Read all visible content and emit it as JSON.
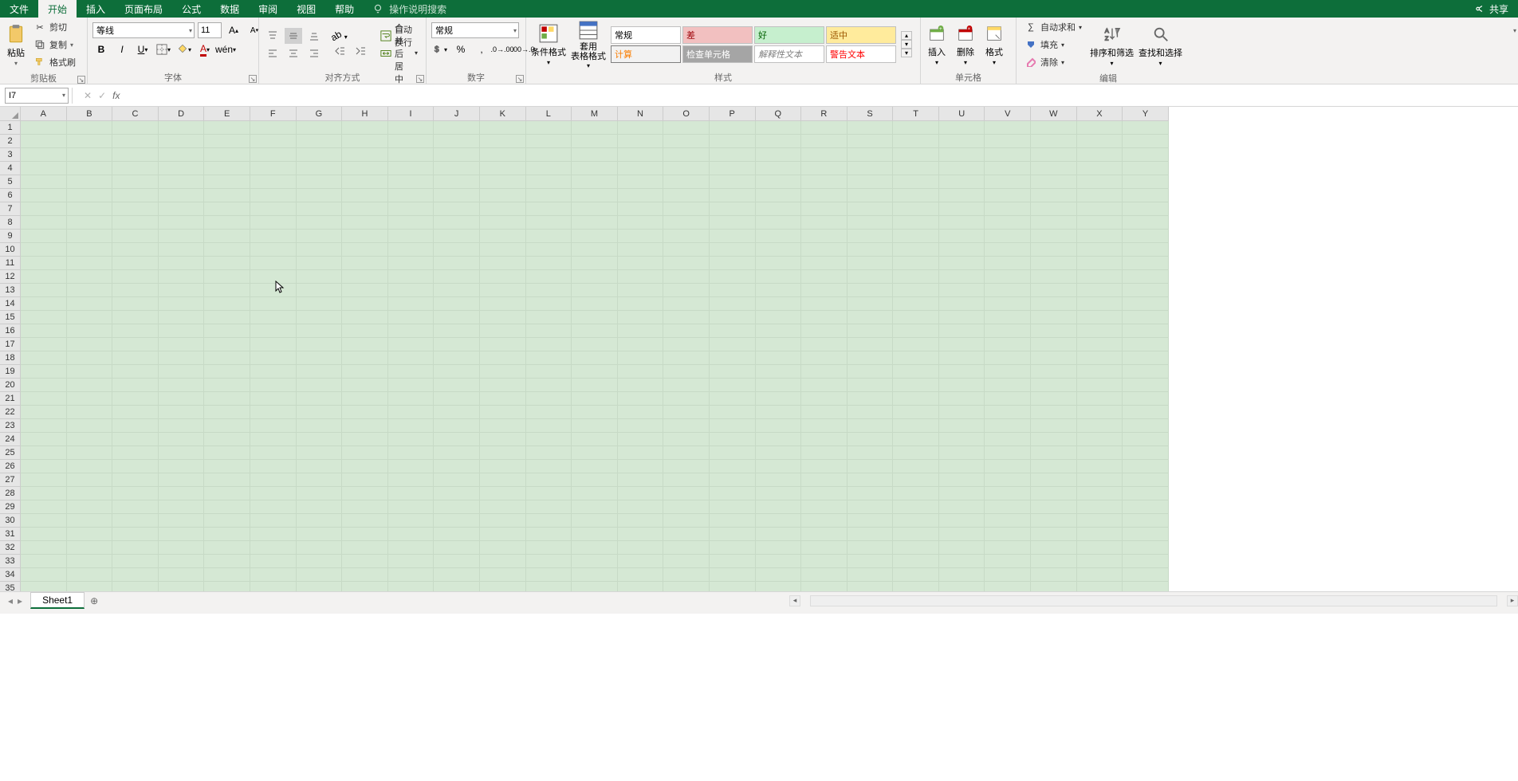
{
  "tabs": {
    "file": "文件",
    "home": "开始",
    "insert": "插入",
    "pageLayout": "页面布局",
    "formulas": "公式",
    "data": "数据",
    "review": "审阅",
    "view": "视图",
    "help": "帮助",
    "tellMe": "操作说明搜索"
  },
  "share": "共享",
  "ribbon": {
    "clipboard": {
      "paste": "粘贴",
      "cut": "剪切",
      "copy": "复制",
      "formatPainter": "格式刷",
      "label": "剪贴板"
    },
    "font": {
      "name": "等线",
      "size": "11",
      "label": "字体"
    },
    "alignment": {
      "wrap": "自动换行",
      "merge": "合并后居中",
      "label": "对齐方式"
    },
    "number": {
      "format": "常规",
      "label": "数字"
    },
    "styles": {
      "condFormat": "条件格式",
      "tableFormat": "套用\n表格格式",
      "normal": "常规",
      "bad": "差",
      "good": "好",
      "neutral": "适中",
      "calc": "计算",
      "check": "检查单元格",
      "explain": "解释性文本",
      "warn": "警告文本",
      "label": "样式"
    },
    "cells": {
      "insert": "插入",
      "delete": "删除",
      "format": "格式",
      "label": "单元格"
    },
    "editing": {
      "autoSum": "自动求和",
      "fill": "填充",
      "clear": "清除",
      "sortFilter": "排序和筛选",
      "findSelect": "查找和选择",
      "label": "编辑"
    }
  },
  "formulaBar": {
    "nameBox": "I7",
    "formula": ""
  },
  "columns": [
    "A",
    "B",
    "C",
    "D",
    "E",
    "F",
    "G",
    "H",
    "I",
    "J",
    "K",
    "L",
    "M",
    "N",
    "O",
    "P",
    "Q",
    "R",
    "S",
    "T",
    "U",
    "V",
    "W",
    "X",
    "Y"
  ],
  "rows": [
    "1",
    "2",
    "3",
    "4",
    "5",
    "6",
    "7",
    "8",
    "9",
    "10",
    "11",
    "12",
    "13",
    "14",
    "15",
    "16",
    "17",
    "18",
    "19",
    "20",
    "21",
    "22",
    "23",
    "24",
    "25",
    "26",
    "27",
    "28",
    "29",
    "30",
    "31",
    "32",
    "33",
    "34",
    "35"
  ],
  "sheet": {
    "name": "Sheet1"
  }
}
